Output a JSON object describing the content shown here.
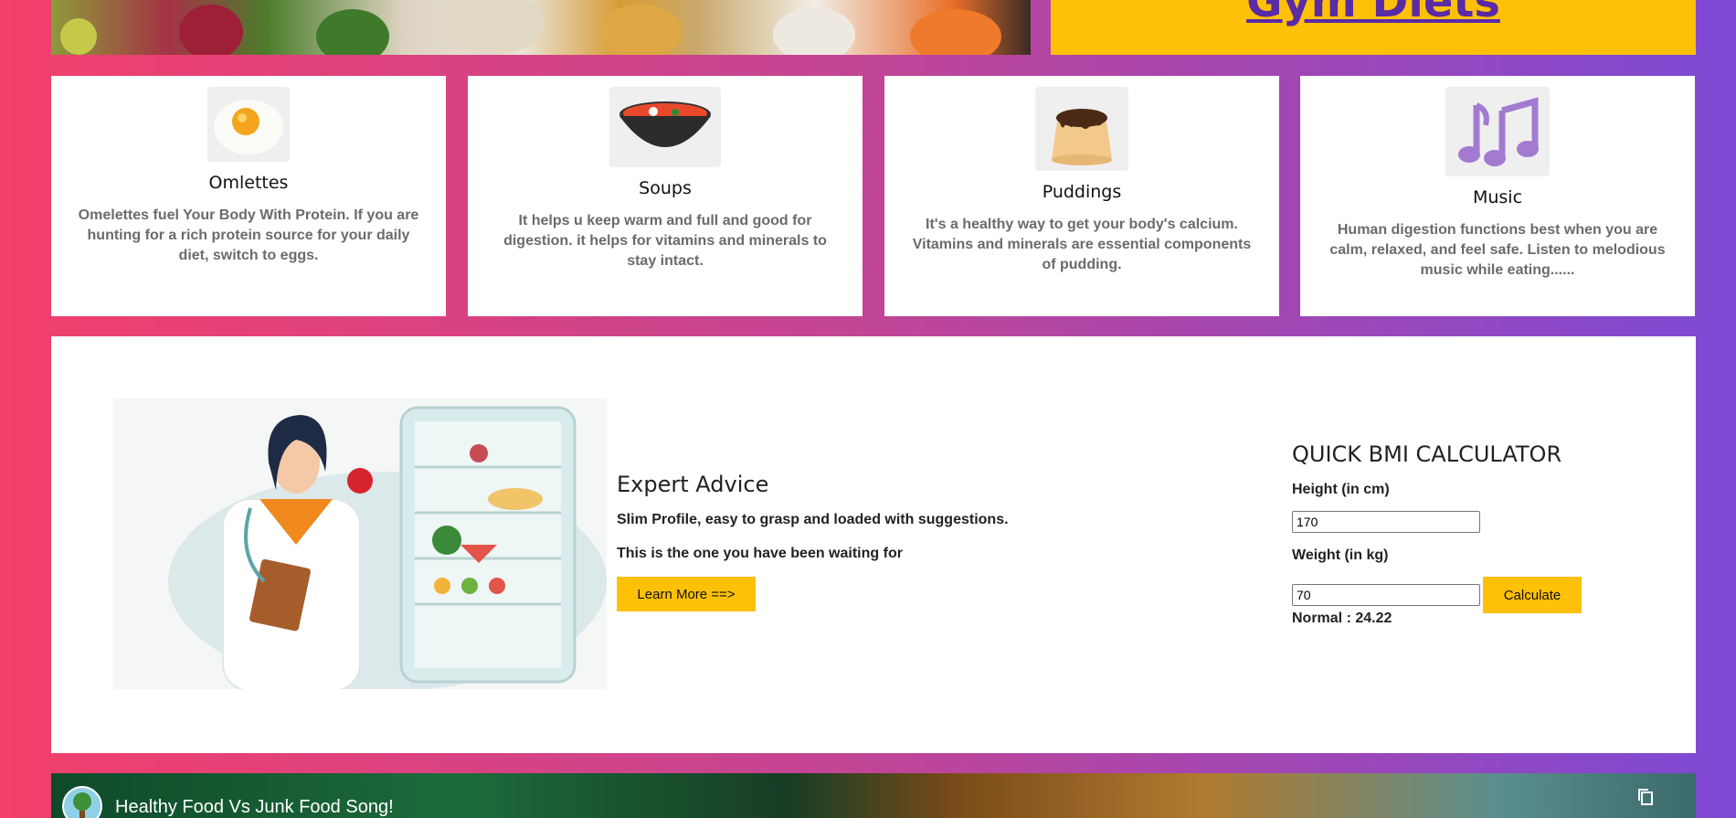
{
  "header": {
    "title": "Gym Diets"
  },
  "cards": [
    {
      "title": "Omlettes",
      "text": "Omelettes fuel Your Body With Protein. If you are hunting for a rich protein source for your daily diet, switch to eggs."
    },
    {
      "title": "Soups",
      "text": "It helps u keep warm and full and good for digestion. it helps for vitamins and minerals to stay intact."
    },
    {
      "title": "Puddings",
      "text": "It's a healthy way to get your body's calcium. Vitamins and minerals are essential components of pudding."
    },
    {
      "title": "Music",
      "text": "Human digestion functions best when you are calm, relaxed, and feel safe. Listen to melodious music while eating......"
    }
  ],
  "advice": {
    "heading": "Expert Advice",
    "line1": "Slim Profile, easy to grasp and loaded with suggestions.",
    "line2": "This is the one you have been waiting for",
    "button": "Learn More ==>"
  },
  "bmi": {
    "heading": "QUICK BMI CALCULATOR",
    "height_label": "Height (in cm)",
    "height_value": "170",
    "weight_label": "Weight (in kg)",
    "weight_value": "70",
    "button": "Calculate",
    "result": "Normal : 24.22"
  },
  "video": {
    "title": "Healthy Food Vs Junk Food Song!",
    "copy_icon": "copy-icon"
  },
  "colors": {
    "accent": "#ffc107",
    "title_link": "#5b2aa6"
  }
}
